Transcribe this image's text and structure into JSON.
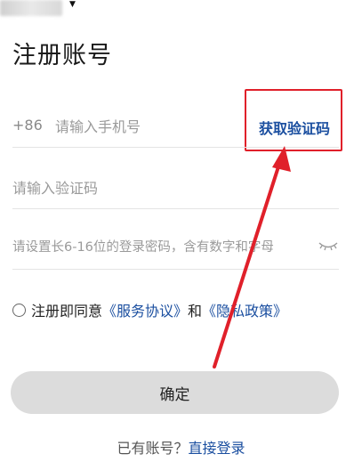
{
  "page": {
    "title": "注册账号"
  },
  "phone": {
    "country_code": "+86",
    "placeholder": "请输入手机号",
    "get_code_label": "获取验证码"
  },
  "verification": {
    "placeholder": "请输入验证码"
  },
  "password": {
    "placeholder": "请设置长6-16位的登录密码，含有数字和字母"
  },
  "agreement": {
    "prefix": "注册即同意",
    "service_link": "《服务协议》",
    "and": "和",
    "privacy_link": "《隐私政策》"
  },
  "confirm": {
    "label": "确定"
  },
  "login": {
    "prompt": "已有账号？",
    "link": "直接登录"
  },
  "colors": {
    "link": "#1b4fa0",
    "annotation": "#e0202a",
    "button_bg": "#dcdcdc"
  }
}
